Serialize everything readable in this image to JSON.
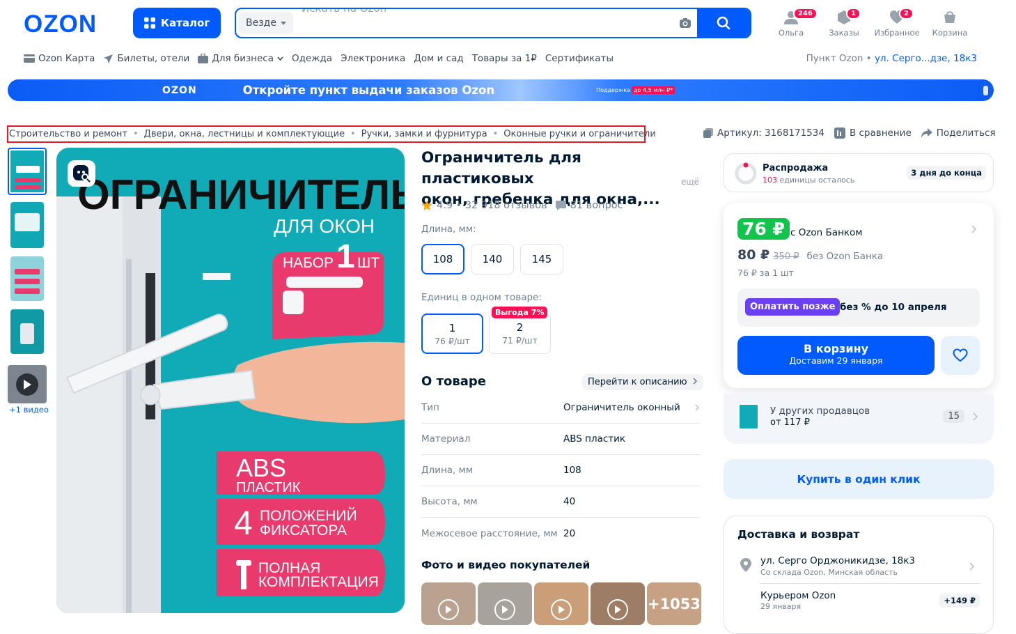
{
  "header": {
    "logo": "OZON",
    "catalog_label": "Каталог",
    "search": {
      "scope": "Везде",
      "placeholder": "Искать на Ozon"
    },
    "icons": [
      {
        "label": "Ольга",
        "badge": "246",
        "icon": "user-icon"
      },
      {
        "label": "Заказы",
        "badge": "1",
        "icon": "box-icon"
      },
      {
        "label": "Избранное",
        "badge": "2",
        "icon": "heart-icon"
      },
      {
        "label": "Корзина",
        "badge": "",
        "icon": "cart-icon"
      }
    ]
  },
  "nav": {
    "items": [
      "Ozon Карта",
      "Билеты, отели",
      "Для бизнеса",
      "Одежда",
      "Электроника",
      "Дом и сад",
      "Товары за 1₽",
      "Сертификаты"
    ],
    "pickup_label": "Пункт Ozon •",
    "pickup_address": "ул. Серго...дзе, 18к3"
  },
  "banner": {
    "logo": "OZON",
    "text": "Откройте пункт выдачи заказов Ozon",
    "support": "Поддержка",
    "support_amount": "до 4,5 млн ₽*"
  },
  "breadcrumbs": [
    "Строительство и ремонт",
    "Двери, окна, лестницы и комплектующие",
    "Ручки, замки и фурнитура",
    "Оконные ручки и ограничители"
  ],
  "meta": {
    "article": "Артикул: 3168171534",
    "compare": "В сравнение",
    "share": "Поделиться"
  },
  "gallery": {
    "video_label": "+1 видео",
    "image_text": {
      "title": "ОГРАНИЧИТЕЛЬ",
      "subtitle": "ДЛЯ ОКОН",
      "set_a": "НАБОР",
      "set_n": "1",
      "set_b": "ШТ",
      "f1_a": "ABS",
      "f1_b": "ПЛАСТИК",
      "f2_n": "4",
      "f2_a": "ПОЛОЖЕНИЙ",
      "f2_b": "ФИКСАТОРА",
      "f3_a": "ПОЛНАЯ",
      "f3_b": "КОМПЛЕКТАЦИЯ"
    }
  },
  "product": {
    "title_line1": "Ограничитель для пластиковых",
    "title_line2": "окон, гребенка для окна,...",
    "more": "ещё",
    "rating": "4.9 • 32 918 отзывов",
    "questions": "81 вопрос",
    "length_label": "Длина, мм:",
    "lengths": [
      "108",
      "140",
      "145"
    ],
    "units_label": "Единиц в одном товаре:",
    "units": [
      {
        "n": "1",
        "price": "76 ₽/шт",
        "tag": ""
      },
      {
        "n": "2",
        "price": "71 ₽/шт",
        "tag": "Выгода 7%"
      }
    ],
    "about_title": "О товаре",
    "goto_desc": "Перейти к описанию",
    "props": [
      {
        "k": "Тип",
        "v": "Ограничитель оконный"
      },
      {
        "k": "Материал",
        "v": "ABS пластик"
      },
      {
        "k": "Длина, мм",
        "v": "108"
      },
      {
        "k": "Высота, мм",
        "v": "40"
      },
      {
        "k": "Межосевое расстояние, мм",
        "v": "20"
      }
    ],
    "photos_title": "Фото и видео покупателей",
    "photos_more": "+1053"
  },
  "sale": {
    "title": "Распродажа",
    "count": "103",
    "count_suffix": "единицы осталось",
    "ends": "3 дня до конца"
  },
  "buy": {
    "price_card": "76 ₽",
    "price_card_label": "с Ozon Банком",
    "price": "80 ₽",
    "old_price": "350 ₽",
    "price_label": "без Ozon Банка",
    "per_unit": "76 ₽ за 1 шт",
    "pay_later": "Оплатить позже",
    "pay_later_note": "без % до 10 апреля",
    "cart_title": "В корзину",
    "cart_sub": "Доставим 29 января",
    "others_title": "У других продавцов",
    "others_price": "от 117 ₽",
    "others_count": "15",
    "one_click": "Купить в один клик"
  },
  "delivery": {
    "title": "Доставка и возврат",
    "address": "ул. Серго Орджоникидзе, 18к3",
    "address_note": "Со склада Ozon, Минская область",
    "courier": "Курьером Ozon",
    "courier_date": "29 января",
    "courier_price": "+149 ₽"
  },
  "colors": {
    "brand": "#005bff",
    "accent": "#f91155",
    "green": "#10c44c",
    "teal": "#11aab7"
  }
}
